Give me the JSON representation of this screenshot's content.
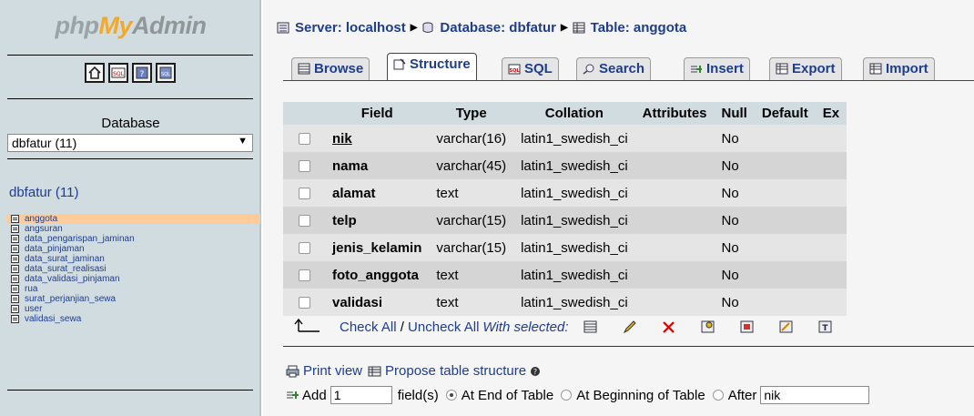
{
  "logo": {
    "php": "php",
    "my": "My",
    "admin": "Admin"
  },
  "quick_icons": [
    "home-icon",
    "sql-query-icon",
    "docs-icon",
    "sql-docs-icon"
  ],
  "sidebar": {
    "db_label": "Database",
    "db_select": "dbfatur (11)",
    "db_heading_name": "dbfatur",
    "db_heading_count": "(11)",
    "tables": [
      "anggota",
      "angsuran",
      "data_pengarispan_jaminan",
      "data_pinjaman",
      "data_surat_jaminan",
      "data_surat_realisasi",
      "data_validasi_pinjaman",
      "rua",
      "surat_perjanjian_sewa",
      "user",
      "validasi_sewa"
    ],
    "active_table": "anggota"
  },
  "breadcrumb": {
    "server": "Server: localhost",
    "database": "Database: dbfatur",
    "table": "Table: anggota"
  },
  "tabs": {
    "browse": "Browse",
    "structure": "Structure",
    "sql": "SQL",
    "search": "Search",
    "insert": "Insert",
    "export": "Export",
    "import": "Import"
  },
  "columns": {
    "field": "Field",
    "type": "Type",
    "collation": "Collation",
    "attributes": "Attributes",
    "null": "Null",
    "default": "Default",
    "extra": "Ex"
  },
  "rows": [
    {
      "field": "nik",
      "type": "varchar(16)",
      "collation": "latin1_swedish_ci",
      "attributes": "",
      "null": "No",
      "default": "",
      "primary": true
    },
    {
      "field": "nama",
      "type": "varchar(45)",
      "collation": "latin1_swedish_ci",
      "attributes": "",
      "null": "No",
      "default": ""
    },
    {
      "field": "alamat",
      "type": "text",
      "collation": "latin1_swedish_ci",
      "attributes": "",
      "null": "No",
      "default": ""
    },
    {
      "field": "telp",
      "type": "varchar(15)",
      "collation": "latin1_swedish_ci",
      "attributes": "",
      "null": "No",
      "default": ""
    },
    {
      "field": "jenis_kelamin",
      "type": "varchar(15)",
      "collation": "latin1_swedish_ci",
      "attributes": "",
      "null": "No",
      "default": ""
    },
    {
      "field": "foto_anggota",
      "type": "text",
      "collation": "latin1_swedish_ci",
      "attributes": "",
      "null": "No",
      "default": ""
    },
    {
      "field": "validasi",
      "type": "text",
      "collation": "latin1_swedish_ci",
      "attributes": "",
      "null": "No",
      "default": ""
    }
  ],
  "checkbar": {
    "check_all": "Check All",
    "slash": " / ",
    "uncheck_all": "Uncheck All",
    "with_selected": "With selected:",
    "actions": [
      "browse-icon",
      "edit-icon",
      "drop-icon",
      "primary-icon",
      "unique-icon",
      "index-icon",
      "fulltext-icon"
    ]
  },
  "footer": {
    "print_view": "Print view",
    "propose": "Propose table structure",
    "add": "Add",
    "add_count": "1",
    "fields_label": "field(s)",
    "at_end": "At End of Table",
    "at_beginning": "At Beginning of Table",
    "after": "After",
    "after_value": "nik"
  }
}
